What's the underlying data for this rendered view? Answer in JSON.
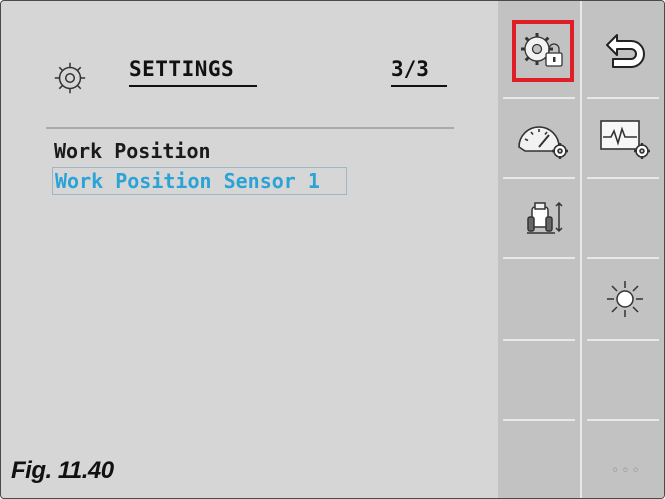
{
  "header": {
    "title": "SETTINGS",
    "page": "3/3"
  },
  "menu": {
    "items": [
      {
        "label": "Work Position",
        "selected": false
      },
      {
        "label": "Work Position Sensor 1",
        "selected": true
      }
    ]
  },
  "caption": "Fig. 11.40",
  "softkeys": {
    "more_label": "◦◦◦",
    "highlight_color": "#e01e25",
    "keys": [
      {
        "icon": "settings-lock-icon",
        "highlighted": true
      },
      {
        "icon": "back-icon"
      },
      {
        "icon": "gauge-settings-icon"
      },
      {
        "icon": "signal-settings-icon"
      },
      {
        "icon": "tractor-height-icon"
      },
      {
        "icon": "brightness-icon"
      }
    ]
  },
  "colors": {
    "background": "#d6d6d6",
    "softkey_panel": "#c2c2c2",
    "selected_text": "#2aa3d7"
  }
}
